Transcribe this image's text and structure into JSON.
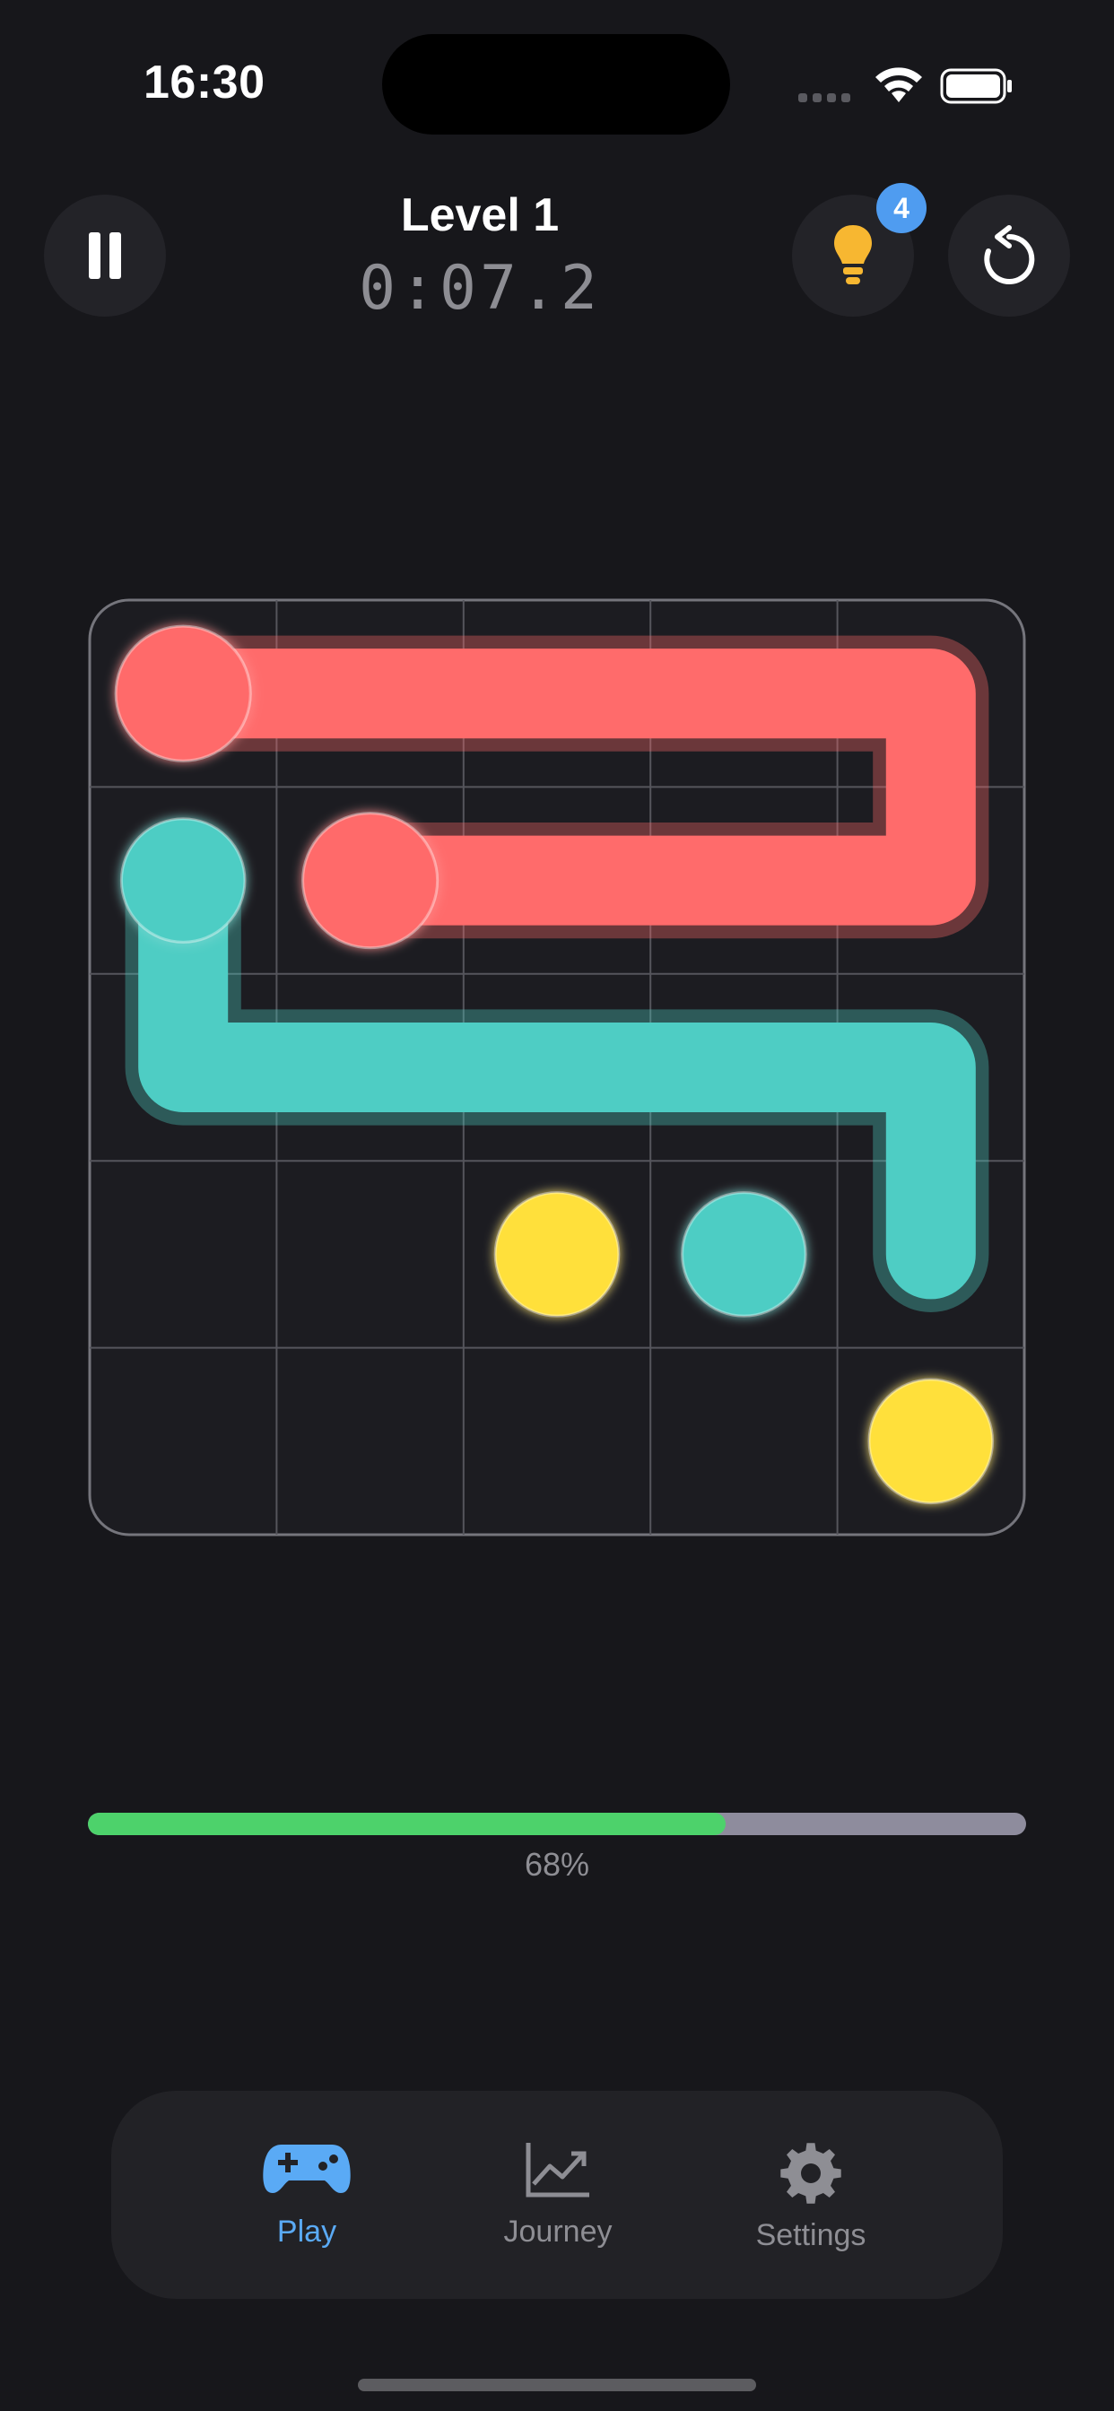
{
  "status_bar": {
    "time": "16:30"
  },
  "header": {
    "level_title": "Level 1",
    "timer": "0:07.2",
    "hint_count": "4"
  },
  "icons": {
    "pause": "pause-icon",
    "hint": "lightbulb-icon",
    "reset": "restart-icon",
    "play_tab": "gamepad-icon",
    "journey_tab": "chart-line-icon",
    "settings_tab": "gear-icon"
  },
  "colors": {
    "red": "#ff6b6b",
    "teal": "#4ecdc4",
    "yellow": "#ffe03a",
    "progress": "#4dd26b",
    "active_tab": "#5aaaf5",
    "hint_bulb": "#f7b731",
    "badge": "#4f9cf0"
  },
  "board": {
    "rows": 5,
    "cols": 5,
    "dots": [
      {
        "color": "red",
        "row": 0,
        "col": 0
      },
      {
        "color": "red",
        "row": 1,
        "col": 1
      },
      {
        "color": "teal",
        "row": 1,
        "col": 0
      },
      {
        "color": "teal",
        "row": 3,
        "col": 3
      },
      {
        "color": "yellow",
        "row": 3,
        "col": 2
      },
      {
        "color": "yellow",
        "row": 4,
        "col": 4
      }
    ],
    "paths": [
      {
        "color": "red",
        "cells": [
          [
            0,
            0
          ],
          [
            0,
            1
          ],
          [
            0,
            2
          ],
          [
            0,
            3
          ],
          [
            0,
            4
          ],
          [
            1,
            4
          ],
          [
            1,
            3
          ],
          [
            1,
            2
          ],
          [
            1,
            1
          ]
        ]
      },
      {
        "color": "teal",
        "cells": [
          [
            1,
            0
          ],
          [
            2,
            0
          ],
          [
            2,
            1
          ],
          [
            2,
            2
          ],
          [
            2,
            3
          ],
          [
            2,
            4
          ],
          [
            3,
            4
          ]
        ]
      }
    ]
  },
  "progress": {
    "value": 0.68,
    "label": "68%"
  },
  "tabs": [
    {
      "label": "Play",
      "active": true
    },
    {
      "label": "Journey",
      "active": false
    },
    {
      "label": "Settings",
      "active": false
    }
  ]
}
